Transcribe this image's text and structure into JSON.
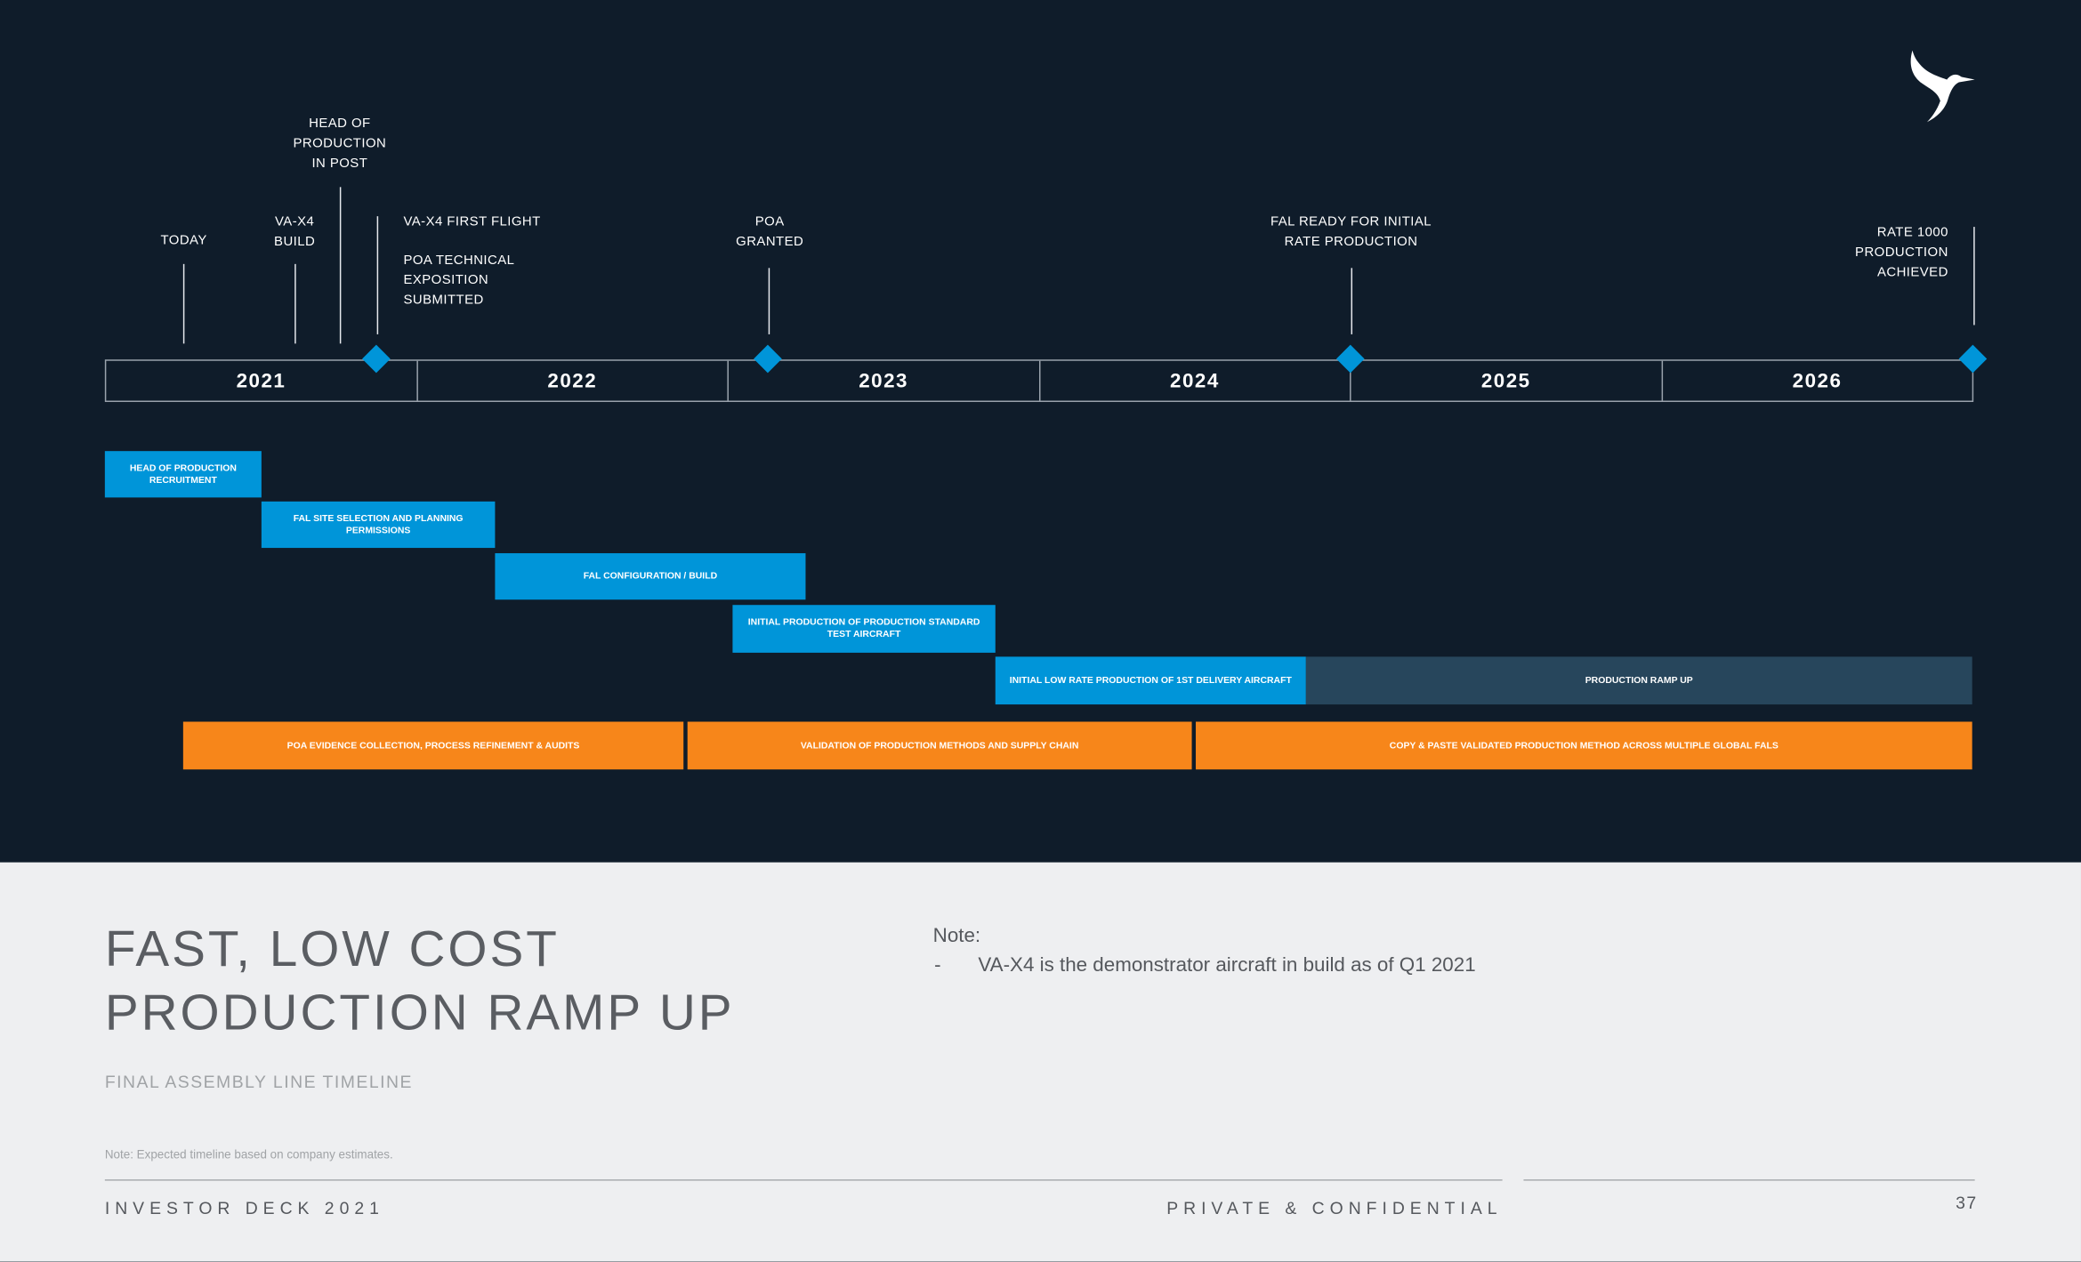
{
  "colors": {
    "background": "#0f1c2a",
    "accent_blue": "#0095d9",
    "ramp": "#27465c",
    "orange": "#f7861a",
    "light_bg": "#eeeff1"
  },
  "logo": {
    "icon": "bird-logo-icon"
  },
  "milestones": {
    "today": [
      "TODAY"
    ],
    "vax4_build": [
      "VA-X4",
      "BUILD"
    ],
    "head_in_post": [
      "HEAD OF",
      "PRODUCTION",
      "IN POST"
    ],
    "first_flight": [
      "VA-X4 FIRST FLIGHT",
      "",
      "POA TECHNICAL",
      "EXPOSITION",
      "SUBMITTED"
    ],
    "poa_granted": [
      "POA",
      "GRANTED"
    ],
    "fal_ready": [
      "FAL READY FOR INITIAL",
      "RATE PRODUCTION"
    ],
    "rate_1000": [
      "RATE 1000",
      "PRODUCTION",
      "ACHIEVED"
    ]
  },
  "years": [
    "2021",
    "2022",
    "2023",
    "2024",
    "2025",
    "2026"
  ],
  "bars": {
    "head_recruitment": "HEAD OF PRODUCTION RECRUITMENT",
    "fal_site": "FAL SITE SELECTION AND PLANNING PERMISSIONS",
    "fal_config": "FAL CONFIGURATION / BUILD",
    "initial_test": "INITIAL PRODUCTION OF PRODUCTION STANDARD TEST AIRCRAFT",
    "low_rate": "INITIAL LOW RATE PRODUCTION OF 1ST DELIVERY AIRCRAFT",
    "ramp_up": "PRODUCTION RAMP UP",
    "poa_evidence": "POA EVIDENCE COLLECTION, PROCESS REFINEMENT & AUDITS",
    "validation": "VALIDATION OF PRODUCTION METHODS AND SUPPLY CHAIN",
    "copy_paste": "COPY & PASTE VALIDATED PRODUCTION METHOD ACROSS MULTIPLE GLOBAL FALS"
  },
  "slide": {
    "title_line1": "FAST, LOW COST",
    "title_line2": "PRODUCTION RAMP UP",
    "subtitle": "FINAL ASSEMBLY LINE TIMELINE",
    "note_heading": "Note:",
    "note_dash": "-",
    "note_text": "VA-X4 is the demonstrator aircraft in build as of Q1 2021",
    "footnote": "Note: Expected timeline based on company estimates.",
    "footer_left": "INVESTOR DECK 2021",
    "footer_right": "PRIVATE & CONFIDENTIAL",
    "page_number": "37"
  }
}
